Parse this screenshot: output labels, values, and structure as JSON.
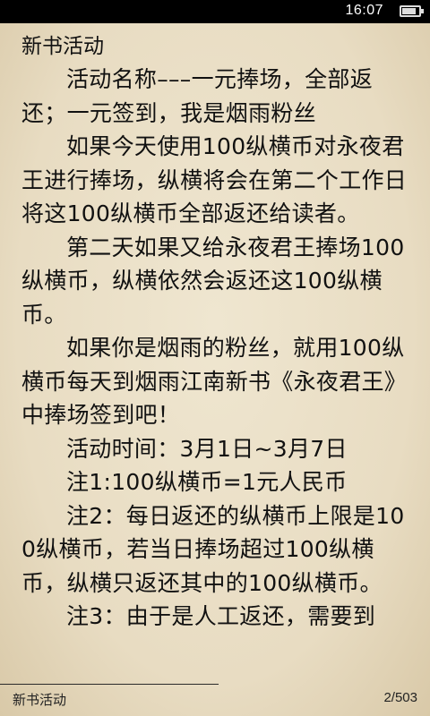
{
  "status_bar": {
    "time": "16:07",
    "battery_level": 0.85
  },
  "reader": {
    "chapter_title": "新书活动",
    "paragraphs": [
      "活动名称–––一元捧场，全部返还；一元签到，我是烟雨粉丝",
      "如果今天使用100纵横币对永夜君王进行捧场，纵横将会在第二个工作日将这100纵横币全部返还给读者。",
      "第二天如果又给永夜君王捧场100纵横币，纵横依然会返还这100纵横币。",
      "如果你是烟雨的粉丝，就用100纵横币每天到烟雨江南新书《永夜君王》中捧场签到吧！",
      "活动时间：3月1日~3月7日",
      "注1:100纵横币=1元人民币",
      "注2：每日返还的纵横币上限是100纵横币，若当日捧场超过100纵横币，纵横只返还其中的100纵横币。",
      "注3：由于是人工返还，需要到"
    ]
  },
  "footer": {
    "chapter_label": "新书活动",
    "page_indicator": "2/503"
  }
}
